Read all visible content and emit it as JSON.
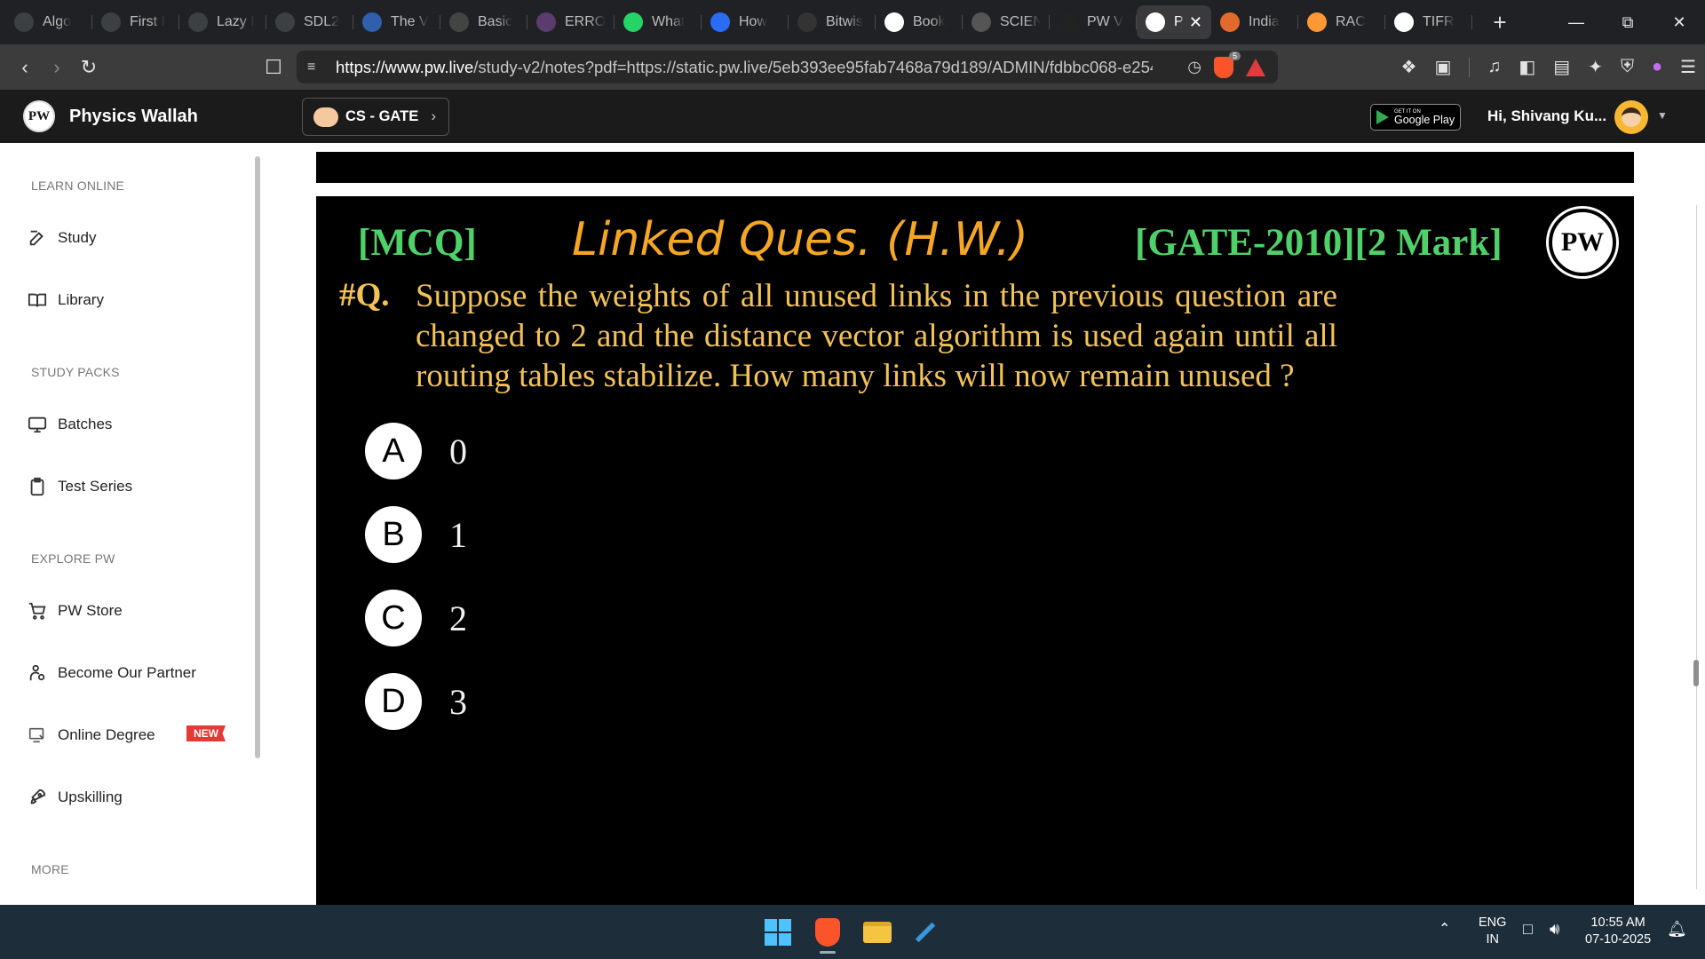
{
  "browser": {
    "tabs": [
      {
        "title": "Algo",
        "icon": "globe-icon",
        "color": "#3c4043"
      },
      {
        "title": "First I",
        "icon": "globe-icon",
        "color": "#3c4043"
      },
      {
        "title": "Lazy I",
        "icon": "globe-icon",
        "color": "#3c4043"
      },
      {
        "title": "SDL2",
        "icon": "globe-icon",
        "color": "#3c4043"
      },
      {
        "title": "The V",
        "icon": "wiki-icon",
        "color": "#2f5fad"
      },
      {
        "title": "Basic",
        "icon": "page-icon",
        "color": "#444"
      },
      {
        "title": "ERRO",
        "icon": "globe-icon",
        "color": "#5a3c6e"
      },
      {
        "title": "What",
        "icon": "whatsapp-icon",
        "color": "#25d366"
      },
      {
        "title": "How",
        "icon": "bookmark-icon",
        "color": "#2a6df4"
      },
      {
        "title": "Bitwis",
        "icon": "geeks-icon",
        "color": "#333"
      },
      {
        "title": "Book",
        "icon": "google-icon",
        "color": "#ffffff"
      },
      {
        "title": "SCIEN",
        "icon": "globe-icon",
        "color": "#555"
      },
      {
        "title": "PW V",
        "icon": "github-icon",
        "color": "#222"
      },
      {
        "title": "P",
        "icon": "pw-icon",
        "color": "#ffffff",
        "active": true
      },
      {
        "title": "India",
        "icon": "burger-icon",
        "color": "#e26a2c"
      },
      {
        "title": "RAC",
        "icon": "flag-icon",
        "color": "#ff9933"
      },
      {
        "title": "TIFR",
        "icon": "google-icon",
        "color": "#ffffff"
      }
    ],
    "url_host": "https://www.pw.live",
    "url_rest": "/study-v2/notes?pdf=https://static.pw.live/5eb393ee95fab7468a79d189/ADMIN/fdbbc068-e254-...",
    "brave_badge": "5"
  },
  "site": {
    "brand": "Physics Wallah",
    "logo_text": "PW",
    "batch": "CS - GATE",
    "google_play_small": "GET IT ON",
    "google_play_big": "Google Play",
    "greeting": "Hi, Shivang Ku..."
  },
  "sidebar": {
    "section_learn": "LEARN ONLINE",
    "section_packs": "STUDY PACKS",
    "section_explore": "EXPLORE PW",
    "section_more": "MORE",
    "study": "Study",
    "library": "Library",
    "batches": "Batches",
    "test_series": "Test Series",
    "store": "PW Store",
    "partner": "Become Our Partner",
    "degree": "Online Degree",
    "new_badge": "NEW",
    "upskilling": "Upskilling"
  },
  "slide": {
    "mcq_tag": "[MCQ]",
    "handwritten_note": "Linked Ques. (H.W.)",
    "exam_tag": "[GATE-2010][2 Mark]",
    "logo_text": "PW",
    "q_label": "#Q.",
    "question": "Suppose the weights of all unused links in the previous question are changed to 2 and the distance vector algorithm is used again until all routing tables stabilize. How many links will now remain unused ?",
    "options": [
      {
        "letter": "A",
        "value": "0"
      },
      {
        "letter": "B",
        "value": "1"
      },
      {
        "letter": "C",
        "value": "2"
      },
      {
        "letter": "D",
        "value": "3"
      }
    ],
    "colors": {
      "tag_green": "#4fd16a",
      "question_yellow": "#f2c255",
      "handwriting_orange": "#f5a623"
    }
  },
  "taskbar": {
    "lang_top": "ENG",
    "lang_bottom": "IN",
    "time": "10:55 AM",
    "date": "07-10-2025"
  }
}
